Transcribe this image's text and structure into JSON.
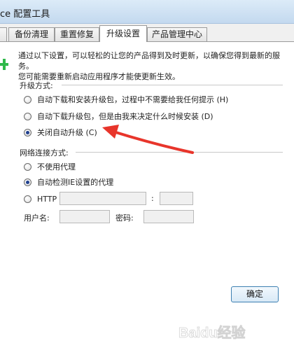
{
  "window": {
    "title": "ce 配置工具"
  },
  "tabs": [
    {
      "label": "备份清理",
      "active": false
    },
    {
      "label": "重置修复",
      "active": false
    },
    {
      "label": "升级设置",
      "active": true
    },
    {
      "label": "产品管理中心",
      "active": false
    }
  ],
  "intro": {
    "line1": "通过以下设置，可以轻松的让您的产品得到及时更新，以确保您得到最新的服务。",
    "line2": "您可能需要重新启动应用程序才能使更新生效。"
  },
  "upgrade": {
    "title": "升级方式:",
    "options": [
      {
        "label": "自动下载和安装升级包，过程中不需要给我任何提示 (H)",
        "checked": false
      },
      {
        "label": "自动下载升级包，但是由我来决定什么时候安装 (D)",
        "checked": false
      },
      {
        "label": "关闭自动升级 (C)",
        "checked": true
      }
    ]
  },
  "network": {
    "title": "网络连接方式:",
    "options": [
      {
        "label": "不使用代理",
        "checked": false
      },
      {
        "label": "自动检测IE设置的代理",
        "checked": true
      },
      {
        "label": "HTTP",
        "checked": false
      }
    ],
    "port_separator": ":",
    "username_label": "用户名:",
    "password_label": "密码:"
  },
  "footer": {
    "ok_label": "确定"
  },
  "watermark": {
    "text": "Baidu经验"
  },
  "colors": {
    "accent_arrow": "#e8352b",
    "side_marker": "#2fb84a"
  }
}
